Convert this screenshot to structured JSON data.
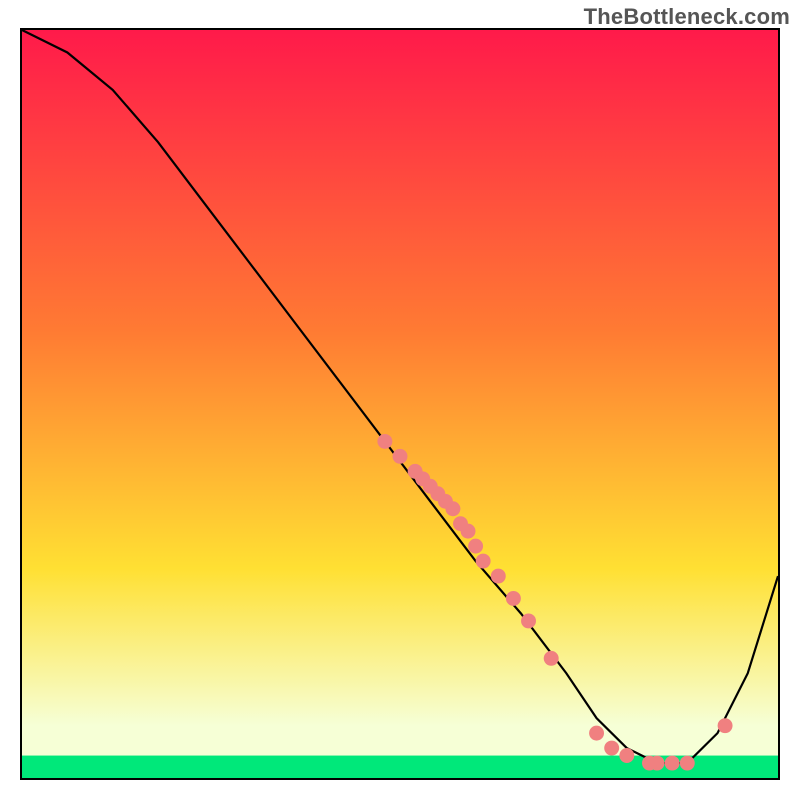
{
  "attribution": "TheBottleneck.com",
  "colors": {
    "gradient_top": "#ff1a4a",
    "gradient_mid1": "#ff7a33",
    "gradient_mid2": "#ffe033",
    "gradient_bottom": "#f6ffd6",
    "green_band": "#00e87a",
    "curve": "#000000",
    "marker": "#f08080",
    "border": "#000000"
  },
  "chart_data": {
    "type": "line",
    "title": "",
    "xlabel": "",
    "ylabel": "",
    "xlim": [
      0,
      100
    ],
    "ylim": [
      0,
      100
    ],
    "curve": {
      "x": [
        0,
        6,
        12,
        18,
        24,
        30,
        36,
        42,
        48,
        54,
        60,
        66,
        72,
        76,
        80,
        84,
        88,
        92,
        96,
        100
      ],
      "y": [
        100,
        97,
        92,
        85,
        77,
        69,
        61,
        53,
        45,
        37,
        29,
        22,
        14,
        8,
        4,
        2,
        2,
        6,
        14,
        27
      ]
    },
    "markers": {
      "x": [
        48,
        50,
        52,
        53,
        54,
        55,
        56,
        57,
        58,
        59,
        60,
        61,
        63,
        65,
        67,
        70,
        76,
        78,
        80,
        83,
        84,
        86,
        88,
        93
      ],
      "y": [
        45,
        43,
        41,
        40,
        39,
        38,
        37,
        36,
        34,
        33,
        31,
        29,
        27,
        24,
        21,
        16,
        6,
        4,
        3,
        2,
        2,
        2,
        2,
        7
      ]
    }
  }
}
